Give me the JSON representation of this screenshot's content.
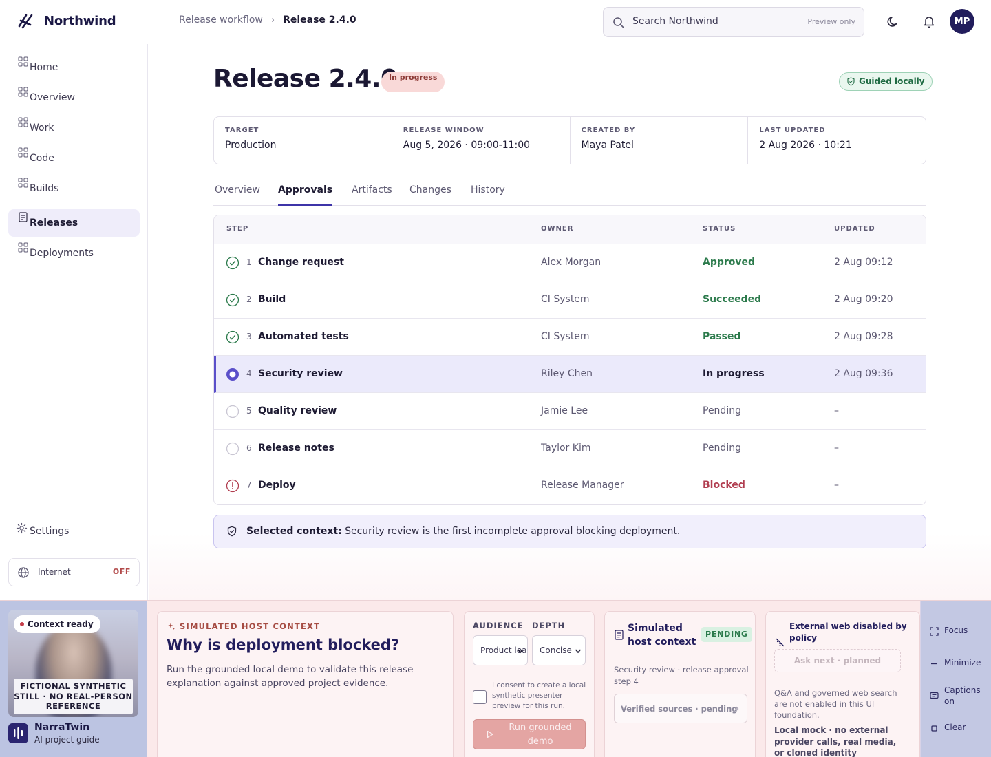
{
  "app": {
    "name": "Northwind"
  },
  "breadcrumb": {
    "parent": "Release workflow",
    "separator": "›",
    "current": "Release 2.4.0"
  },
  "search": {
    "placeholder": "Search Northwind",
    "badge": "Preview only"
  },
  "user": {
    "initials": "MP"
  },
  "sidebar": {
    "items": [
      {
        "label": "Home",
        "icon": "grid-icon",
        "active": false
      },
      {
        "label": "Overview",
        "icon": "grid-icon",
        "active": false
      },
      {
        "label": "Work",
        "icon": "grid-icon",
        "active": false
      },
      {
        "label": "Code",
        "icon": "grid-icon",
        "active": false
      },
      {
        "label": "Builds",
        "icon": "grid-icon",
        "active": false
      },
      {
        "label": "Releases",
        "icon": "document-icon",
        "active": true
      },
      {
        "label": "Deployments",
        "icon": "grid-icon",
        "active": false
      }
    ],
    "settings_label": "Settings",
    "internet": {
      "label": "Internet",
      "state": "OFF"
    }
  },
  "page": {
    "title": "Release 2.4.0",
    "status": "In progress",
    "guided": "Guided locally"
  },
  "meta": [
    {
      "key": "TARGET",
      "value": "Production"
    },
    {
      "key": "RELEASE WINDOW",
      "value": "Aug 5, 2026 · 09:00-11:00"
    },
    {
      "key": "CREATED BY",
      "value": "Maya Patel"
    },
    {
      "key": "LAST UPDATED",
      "value": "2 Aug 2026 · 10:21"
    }
  ],
  "tabs": [
    "Overview",
    "Approvals",
    "Artifacts",
    "Changes",
    "History"
  ],
  "active_tab": "Approvals",
  "table": {
    "headers": {
      "step": "STEP",
      "owner": "OWNER",
      "status": "STATUS",
      "updated": "UPDATED"
    },
    "rows": [
      {
        "num": "1",
        "step": "Change request",
        "owner": "Alex Morgan",
        "status": "Approved",
        "updated": "2 Aug 09:12",
        "state": "done"
      },
      {
        "num": "2",
        "step": "Build",
        "owner": "CI System",
        "status": "Succeeded",
        "updated": "2 Aug 09:20",
        "state": "done"
      },
      {
        "num": "3",
        "step": "Automated tests",
        "owner": "CI System",
        "status": "Passed",
        "updated": "2 Aug 09:28",
        "state": "done"
      },
      {
        "num": "4",
        "step": "Security review",
        "owner": "Riley Chen",
        "status": "In progress",
        "updated": "2 Aug 09:36",
        "state": "current"
      },
      {
        "num": "5",
        "step": "Quality review",
        "owner": "Jamie Lee",
        "status": "Pending",
        "updated": "–",
        "state": "pending"
      },
      {
        "num": "6",
        "step": "Release notes",
        "owner": "Taylor Kim",
        "status": "Pending",
        "updated": "–",
        "state": "pending"
      },
      {
        "num": "7",
        "step": "Deploy",
        "owner": "Release Manager",
        "status": "Blocked",
        "updated": "–",
        "state": "blocked"
      }
    ]
  },
  "context": {
    "label": "Selected context:",
    "text": "Security review is the first incomplete approval blocking deployment."
  },
  "presenter": {
    "status": "Context ready",
    "disclaimer": "FICTIONAL SYNTHETIC STILL · NO REAL-PERSON REFERENCE",
    "name": "NarraTwin",
    "role": "AI project guide"
  },
  "simulated": {
    "kicker": "SIMULATED HOST CONTEXT",
    "title": "Why is deployment blocked?",
    "description": "Run the grounded local demo to validate this release explanation against approved project evidence."
  },
  "controls": {
    "audience_label": "AUDIENCE",
    "audience_value": "Product lead",
    "depth_label": "DEPTH",
    "depth_value": "Concise",
    "consent": "I consent to create a local synthetic presenter preview for this run.",
    "run_button": "Run grounded demo"
  },
  "host": {
    "title": "Simulated host context",
    "badge": "PENDING",
    "description": "Security review · release approval step 4",
    "verified": "Verified sources · pending"
  },
  "external": {
    "title": "External web disabled by policy",
    "ask_next": "Ask next · planned",
    "description": "Q&A and governed web search are not enabled in this UI foundation.",
    "note": "Local mock · no external provider calls, real media, or cloned identity"
  },
  "side_controls": [
    {
      "label": "Focus",
      "icon": "focus-icon"
    },
    {
      "label": "Minimize",
      "icon": "minimize-icon"
    },
    {
      "label": "Captions on",
      "icon": "captions-icon"
    },
    {
      "label": "Clear",
      "icon": "clear-icon"
    }
  ],
  "colors": {
    "brand": "#221d5c",
    "accent": "#5a4fc9",
    "success": "#2b7a4b",
    "danger": "#b13e50",
    "status_pill_bg": "#f9d9d8"
  }
}
